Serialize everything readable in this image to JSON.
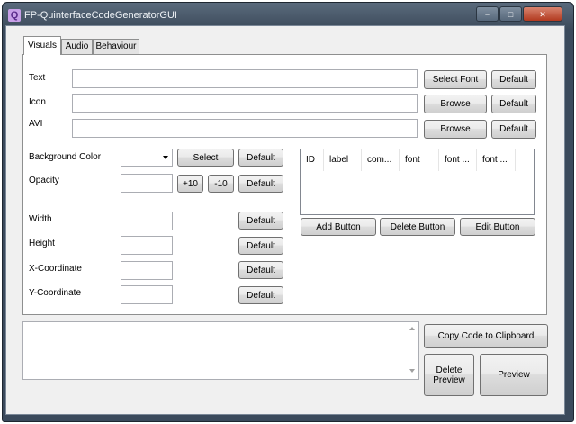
{
  "window": {
    "title": "FP-QuinterfaceCodeGeneratorGUI",
    "app_icon": "Q"
  },
  "title_controls": {
    "minimize": "−",
    "maximize": "□",
    "close": "✕"
  },
  "tabs": [
    {
      "label": "Visuals",
      "active": true
    },
    {
      "label": "Audio",
      "active": false
    },
    {
      "label": "Behaviour",
      "active": false
    }
  ],
  "visuals": {
    "text_label": "Text",
    "text_value": "",
    "select_font": "Select Font",
    "icon_label": "Icon",
    "icon_value": "",
    "avi_label": "AVI",
    "avi_value": "",
    "browse": "Browse",
    "default": "Default",
    "bg_color_label": "Background Color",
    "bg_color_value": "",
    "select": "Select",
    "opacity_label": "Opacity",
    "opacity_value": "",
    "plus10": "+10",
    "minus10": "-10",
    "width_label": "Width",
    "height_label": "Height",
    "x_label": "X-Coordinate",
    "y_label": "Y-Coordinate",
    "buttons_list": {
      "columns": [
        "ID",
        "label",
        "com...",
        "font",
        "font ...",
        "font ..."
      ]
    },
    "add_button": "Add Button",
    "delete_button": "Delete Button",
    "edit_button": "Edit Button"
  },
  "bottom": {
    "code_output": "",
    "copy_code": "Copy Code to Clipboard",
    "delete_preview": "Delete\nPreview",
    "preview": "Preview"
  }
}
